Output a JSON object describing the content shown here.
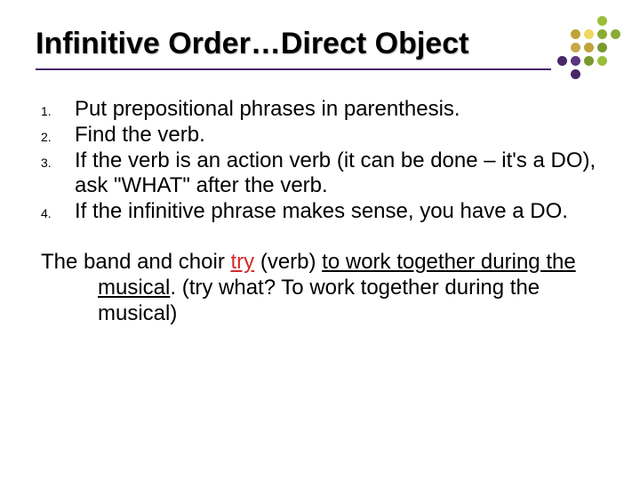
{
  "title": "Infinitive Order…Direct Object",
  "numbers": [
    "1.",
    "2.",
    "3.",
    "4."
  ],
  "items": [
    "Put prepositional phrases in parenthesis.",
    "Find the verb.",
    "If the verb is an action verb (it can be done – it's a DO), ask \"WHAT\" after the verb.",
    "If the infinitive phrase makes sense, you have a DO."
  ],
  "example": {
    "lead": "The band and choir ",
    "try": "try",
    "verb_note": " (verb) ",
    "infinitive": "to work together during the musical",
    "period": ". ",
    "paren": "(try what? To work together during the musical)"
  },
  "dot_colors": [
    "",
    "",
    "",
    "#9bbf3a",
    "",
    "",
    "#bfa23a",
    "#f0d860",
    "#8aab34",
    "#8aab34",
    "",
    "#c6a84a",
    "#bfa23a",
    "#7a9a2f",
    "",
    "#472766",
    "#5a3780",
    "#7a9a2f",
    "#9bbf3a",
    "",
    "",
    "#472766",
    "",
    "",
    ""
  ]
}
